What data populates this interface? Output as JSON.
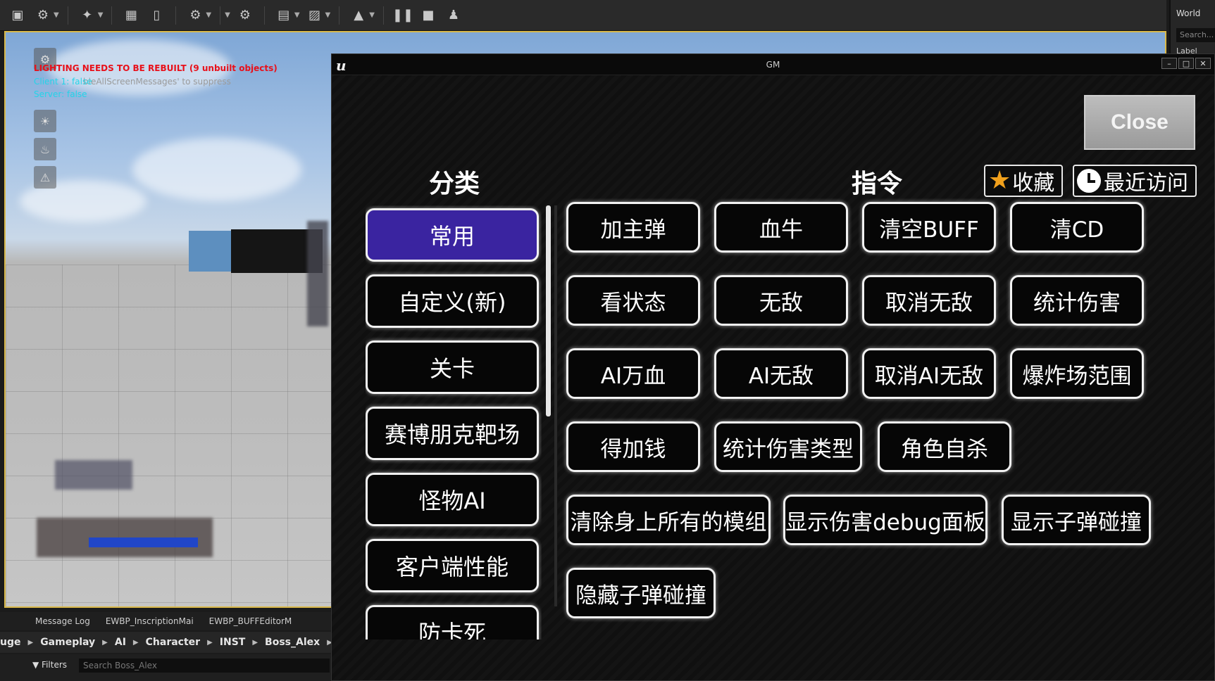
{
  "outliner": {
    "title": "World",
    "search_placeholder": "Search...",
    "label_header": "Label"
  },
  "viewport": {
    "lighting_warning": "LIGHTING NEEDS TO BE REBUILT (9 unbuilt objects)",
    "client_status": "Client 1: false",
    "server_status": "Server: false",
    "suppress_hint": "bleAllScreenMessages' to suppress"
  },
  "bottom_tabs": [
    "Message Log",
    "EWBP_InscriptionMai",
    "EWBP_BUFFEditorM"
  ],
  "breadcrumbs": [
    "uge",
    "Gameplay",
    "AI",
    "Character",
    "INST",
    "Boss_Alex"
  ],
  "filters": {
    "label": "Filters",
    "search_placeholder": "Search Boss_Alex"
  },
  "gm": {
    "window_title": "GM",
    "logo": "u",
    "close_label": "Close",
    "category_header": "分类",
    "command_header": "指令",
    "favorites_label": "收藏",
    "recent_label": "最近访问",
    "categories": [
      "常用",
      "自定义(新)",
      "关卡",
      "赛博朋克靶场",
      "怪物AI",
      "客户端性能",
      "防卡死"
    ],
    "active_category": "常用",
    "commands": [
      "加主弹",
      "血牛",
      "清空BUFF",
      "清CD",
      "看状态",
      "无敌",
      "取消无敌",
      "统计伤害",
      "AI万血",
      "AI无敌",
      "取消AI无敌",
      "爆炸场范围",
      "得加钱",
      "统计伤害类型",
      "角色自杀",
      "清除身上所有的模组",
      "显示伤害debug面板",
      "显示子弹碰撞",
      "隐藏子弹碰撞"
    ]
  },
  "colors": {
    "active_category_bg": "#3a24a0",
    "button_border": "#f2f2f2",
    "star": "#f0a01c",
    "warning_red": "#e8101a",
    "status_cyan": "#23d4e8"
  }
}
